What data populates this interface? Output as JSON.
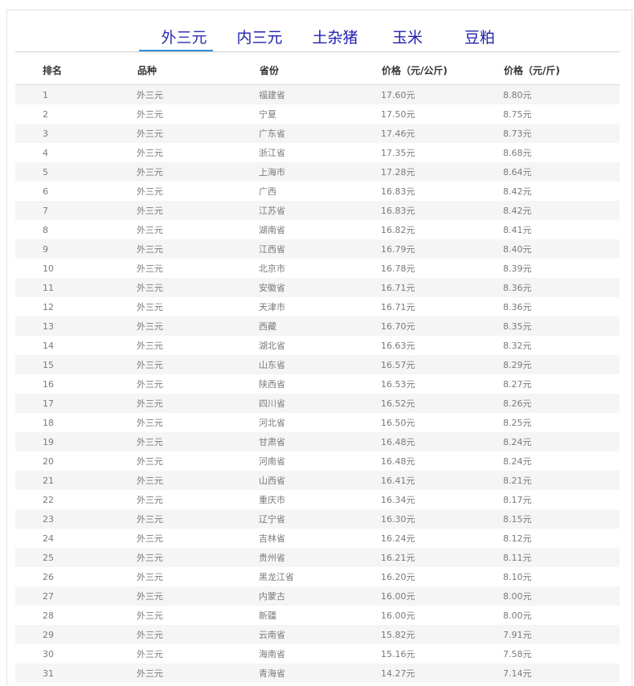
{
  "tabs": [
    {
      "label": "外三元",
      "active": true
    },
    {
      "label": "内三元",
      "active": false
    },
    {
      "label": "土杂猪",
      "active": false
    },
    {
      "label": "玉米",
      "active": false
    },
    {
      "label": "豆粕",
      "active": false
    }
  ],
  "table": {
    "headers": [
      "排名",
      "品种",
      "省份",
      "价格（元/公斤)",
      "价格（元/斤)"
    ],
    "rows": [
      [
        "1",
        "外三元",
        "福建省",
        "17.60元",
        "8.80元"
      ],
      [
        "2",
        "外三元",
        "宁夏",
        "17.50元",
        "8.75元"
      ],
      [
        "3",
        "外三元",
        "广东省",
        "17.46元",
        "8.73元"
      ],
      [
        "4",
        "外三元",
        "浙江省",
        "17.35元",
        "8.68元"
      ],
      [
        "5",
        "外三元",
        "上海市",
        "17.28元",
        "8.64元"
      ],
      [
        "6",
        "外三元",
        "广西",
        "16.83元",
        "8.42元"
      ],
      [
        "7",
        "外三元",
        "江苏省",
        "16.83元",
        "8.42元"
      ],
      [
        "8",
        "外三元",
        "湖南省",
        "16.82元",
        "8.41元"
      ],
      [
        "9",
        "外三元",
        "江西省",
        "16.79元",
        "8.40元"
      ],
      [
        "10",
        "外三元",
        "北京市",
        "16.78元",
        "8.39元"
      ],
      [
        "11",
        "外三元",
        "安徽省",
        "16.71元",
        "8.36元"
      ],
      [
        "12",
        "外三元",
        "天津市",
        "16.71元",
        "8.36元"
      ],
      [
        "13",
        "外三元",
        "西藏",
        "16.70元",
        "8.35元"
      ],
      [
        "14",
        "外三元",
        "湖北省",
        "16.63元",
        "8.32元"
      ],
      [
        "15",
        "外三元",
        "山东省",
        "16.57元",
        "8.29元"
      ],
      [
        "16",
        "外三元",
        "陕西省",
        "16.53元",
        "8.27元"
      ],
      [
        "17",
        "外三元",
        "四川省",
        "16.52元",
        "8.26元"
      ],
      [
        "18",
        "外三元",
        "河北省",
        "16.50元",
        "8.25元"
      ],
      [
        "19",
        "外三元",
        "甘肃省",
        "16.48元",
        "8.24元"
      ],
      [
        "20",
        "外三元",
        "河南省",
        "16.48元",
        "8.24元"
      ],
      [
        "21",
        "外三元",
        "山西省",
        "16.41元",
        "8.21元"
      ],
      [
        "22",
        "外三元",
        "重庆市",
        "16.34元",
        "8.17元"
      ],
      [
        "23",
        "外三元",
        "辽宁省",
        "16.30元",
        "8.15元"
      ],
      [
        "24",
        "外三元",
        "吉林省",
        "16.24元",
        "8.12元"
      ],
      [
        "25",
        "外三元",
        "贵州省",
        "16.21元",
        "8.11元"
      ],
      [
        "26",
        "外三元",
        "黑龙江省",
        "16.20元",
        "8.10元"
      ],
      [
        "27",
        "外三元",
        "内蒙古",
        "16.00元",
        "8.00元"
      ],
      [
        "28",
        "外三元",
        "新疆",
        "16.00元",
        "8.00元"
      ],
      [
        "29",
        "外三元",
        "云南省",
        "15.82元",
        "7.91元"
      ],
      [
        "30",
        "外三元",
        "海南省",
        "15.16元",
        "7.58元"
      ],
      [
        "31",
        "外三元",
        "青海省",
        "14.27元",
        "7.14元"
      ]
    ]
  }
}
